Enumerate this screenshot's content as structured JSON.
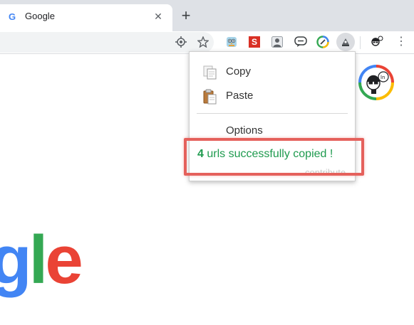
{
  "tab": {
    "favicon": "G",
    "title": "Google",
    "close": "✕"
  },
  "new_tab": "+",
  "toolbar": {
    "icons": [
      "location-target-icon",
      "star-bookmark-icon",
      "owl-extension-icon",
      "s-extension-icon",
      "person-extension-icon",
      "chat-extension-icon",
      "swirl-extension-icon",
      "copy-urls-extension-icon",
      "profile-icon",
      "more-menu-icon"
    ],
    "s_extension_letter": "S",
    "menu": "⋮"
  },
  "popup": {
    "copy_label": "Copy",
    "paste_label": "Paste",
    "options_label": "Options",
    "status_count": "4",
    "status_text": " urls successfully copied !",
    "contribute_label": "contribute"
  },
  "page": {
    "logo_fragment_g": "g",
    "logo_fragment_l": "l",
    "logo_fragment_e": "e"
  },
  "colors": {
    "status_green": "#1e9a4e",
    "highlight_red": "#e5615c",
    "google_blue": "#4285f4",
    "google_green": "#34a853",
    "google_red": "#ea4335",
    "google_yellow": "#fbbc05"
  }
}
